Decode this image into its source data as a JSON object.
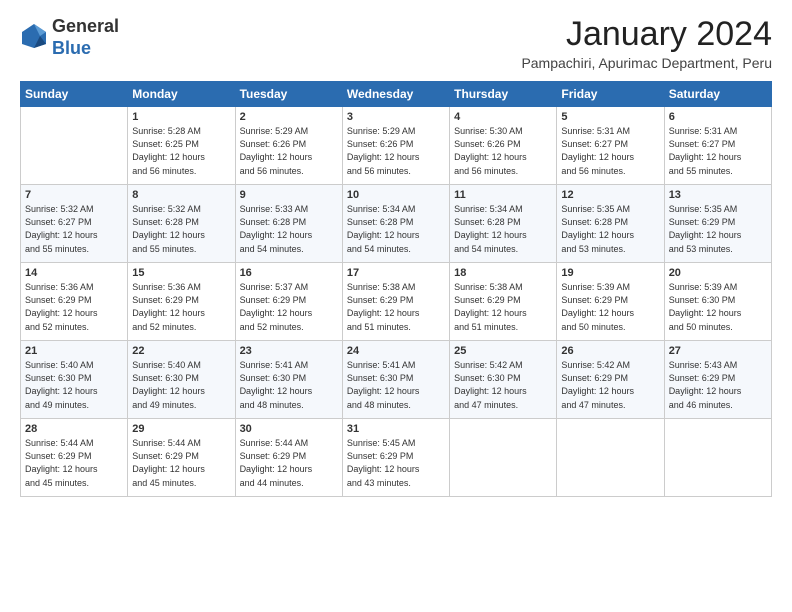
{
  "header": {
    "logo_general": "General",
    "logo_blue": "Blue",
    "title": "January 2024",
    "location": "Pampachiri, Apurimac Department, Peru"
  },
  "days_of_week": [
    "Sunday",
    "Monday",
    "Tuesday",
    "Wednesday",
    "Thursday",
    "Friday",
    "Saturday"
  ],
  "weeks": [
    [
      {
        "day": "",
        "info": ""
      },
      {
        "day": "1",
        "info": "Sunrise: 5:28 AM\nSunset: 6:25 PM\nDaylight: 12 hours\nand 56 minutes."
      },
      {
        "day": "2",
        "info": "Sunrise: 5:29 AM\nSunset: 6:26 PM\nDaylight: 12 hours\nand 56 minutes."
      },
      {
        "day": "3",
        "info": "Sunrise: 5:29 AM\nSunset: 6:26 PM\nDaylight: 12 hours\nand 56 minutes."
      },
      {
        "day": "4",
        "info": "Sunrise: 5:30 AM\nSunset: 6:26 PM\nDaylight: 12 hours\nand 56 minutes."
      },
      {
        "day": "5",
        "info": "Sunrise: 5:31 AM\nSunset: 6:27 PM\nDaylight: 12 hours\nand 56 minutes."
      },
      {
        "day": "6",
        "info": "Sunrise: 5:31 AM\nSunset: 6:27 PM\nDaylight: 12 hours\nand 55 minutes."
      }
    ],
    [
      {
        "day": "7",
        "info": "Sunrise: 5:32 AM\nSunset: 6:27 PM\nDaylight: 12 hours\nand 55 minutes."
      },
      {
        "day": "8",
        "info": "Sunrise: 5:32 AM\nSunset: 6:28 PM\nDaylight: 12 hours\nand 55 minutes."
      },
      {
        "day": "9",
        "info": "Sunrise: 5:33 AM\nSunset: 6:28 PM\nDaylight: 12 hours\nand 54 minutes."
      },
      {
        "day": "10",
        "info": "Sunrise: 5:34 AM\nSunset: 6:28 PM\nDaylight: 12 hours\nand 54 minutes."
      },
      {
        "day": "11",
        "info": "Sunrise: 5:34 AM\nSunset: 6:28 PM\nDaylight: 12 hours\nand 54 minutes."
      },
      {
        "day": "12",
        "info": "Sunrise: 5:35 AM\nSunset: 6:28 PM\nDaylight: 12 hours\nand 53 minutes."
      },
      {
        "day": "13",
        "info": "Sunrise: 5:35 AM\nSunset: 6:29 PM\nDaylight: 12 hours\nand 53 minutes."
      }
    ],
    [
      {
        "day": "14",
        "info": "Sunrise: 5:36 AM\nSunset: 6:29 PM\nDaylight: 12 hours\nand 52 minutes."
      },
      {
        "day": "15",
        "info": "Sunrise: 5:36 AM\nSunset: 6:29 PM\nDaylight: 12 hours\nand 52 minutes."
      },
      {
        "day": "16",
        "info": "Sunrise: 5:37 AM\nSunset: 6:29 PM\nDaylight: 12 hours\nand 52 minutes."
      },
      {
        "day": "17",
        "info": "Sunrise: 5:38 AM\nSunset: 6:29 PM\nDaylight: 12 hours\nand 51 minutes."
      },
      {
        "day": "18",
        "info": "Sunrise: 5:38 AM\nSunset: 6:29 PM\nDaylight: 12 hours\nand 51 minutes."
      },
      {
        "day": "19",
        "info": "Sunrise: 5:39 AM\nSunset: 6:29 PM\nDaylight: 12 hours\nand 50 minutes."
      },
      {
        "day": "20",
        "info": "Sunrise: 5:39 AM\nSunset: 6:30 PM\nDaylight: 12 hours\nand 50 minutes."
      }
    ],
    [
      {
        "day": "21",
        "info": "Sunrise: 5:40 AM\nSunset: 6:30 PM\nDaylight: 12 hours\nand 49 minutes."
      },
      {
        "day": "22",
        "info": "Sunrise: 5:40 AM\nSunset: 6:30 PM\nDaylight: 12 hours\nand 49 minutes."
      },
      {
        "day": "23",
        "info": "Sunrise: 5:41 AM\nSunset: 6:30 PM\nDaylight: 12 hours\nand 48 minutes."
      },
      {
        "day": "24",
        "info": "Sunrise: 5:41 AM\nSunset: 6:30 PM\nDaylight: 12 hours\nand 48 minutes."
      },
      {
        "day": "25",
        "info": "Sunrise: 5:42 AM\nSunset: 6:30 PM\nDaylight: 12 hours\nand 47 minutes."
      },
      {
        "day": "26",
        "info": "Sunrise: 5:42 AM\nSunset: 6:29 PM\nDaylight: 12 hours\nand 47 minutes."
      },
      {
        "day": "27",
        "info": "Sunrise: 5:43 AM\nSunset: 6:29 PM\nDaylight: 12 hours\nand 46 minutes."
      }
    ],
    [
      {
        "day": "28",
        "info": "Sunrise: 5:44 AM\nSunset: 6:29 PM\nDaylight: 12 hours\nand 45 minutes."
      },
      {
        "day": "29",
        "info": "Sunrise: 5:44 AM\nSunset: 6:29 PM\nDaylight: 12 hours\nand 45 minutes."
      },
      {
        "day": "30",
        "info": "Sunrise: 5:44 AM\nSunset: 6:29 PM\nDaylight: 12 hours\nand 44 minutes."
      },
      {
        "day": "31",
        "info": "Sunrise: 5:45 AM\nSunset: 6:29 PM\nDaylight: 12 hours\nand 43 minutes."
      },
      {
        "day": "",
        "info": ""
      },
      {
        "day": "",
        "info": ""
      },
      {
        "day": "",
        "info": ""
      }
    ]
  ]
}
